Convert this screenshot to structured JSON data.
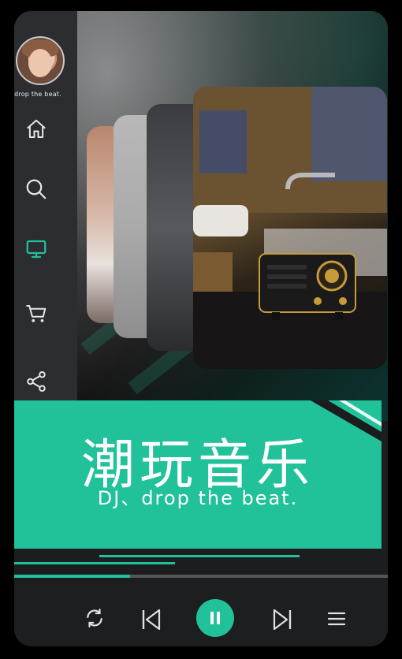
{
  "profile": {
    "caption": "drop the beat."
  },
  "nav": {
    "items": [
      {
        "icon": "home-icon",
        "active": false
      },
      {
        "icon": "search-icon",
        "active": false
      },
      {
        "icon": "monitor-icon",
        "active": true
      },
      {
        "icon": "cart-icon",
        "active": false
      },
      {
        "icon": "share-icon",
        "active": false
      }
    ]
  },
  "banner": {
    "title": "潮玩音乐",
    "subtitle": "DJ、drop the beat."
  },
  "player": {
    "progress": 0.31,
    "controls": [
      "repeat-icon",
      "previous-icon",
      "pause-icon",
      "next-icon",
      "menu-icon"
    ]
  },
  "colors": {
    "accent": "#21c19a",
    "sidebar": "#2d2f32",
    "icon": "#e6e6e6",
    "background": "#000000"
  }
}
